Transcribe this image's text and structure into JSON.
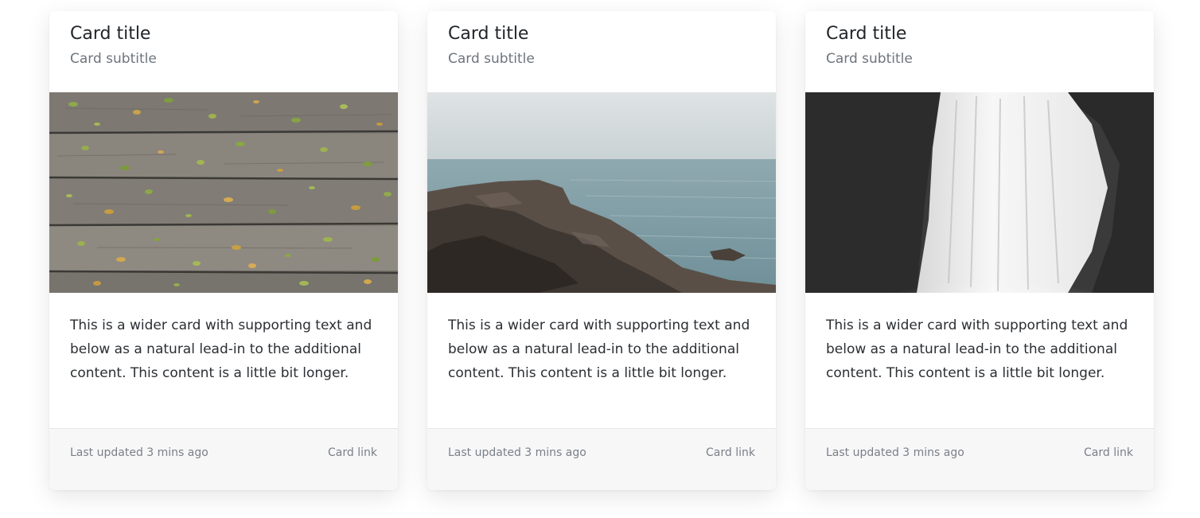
{
  "cards": [
    {
      "title": "Card title",
      "subtitle": "Card subtitle",
      "image": "wooden-deck-leaves-photo",
      "text": "This is a wider card with supporting text and below as a natural lead-in to the additional content. This content is a little bit longer.",
      "updated": "Last updated 3 mins ago",
      "link": "Card link"
    },
    {
      "title": "Card title",
      "subtitle": "Card subtitle",
      "image": "rocky-coast-sea-photo",
      "text": "This is a wider card with supporting text and below as a natural lead-in to the additional content. This content is a little bit longer.",
      "updated": "Last updated 3 mins ago",
      "link": "Card link"
    },
    {
      "title": "Card title",
      "subtitle": "Card subtitle",
      "image": "waterfall-photo",
      "text": "This is a wider card with supporting text and below as a natural lead-in to the additional content. This content is a little bit longer.",
      "updated": "Last updated 3 mins ago",
      "link": "Card link"
    }
  ]
}
